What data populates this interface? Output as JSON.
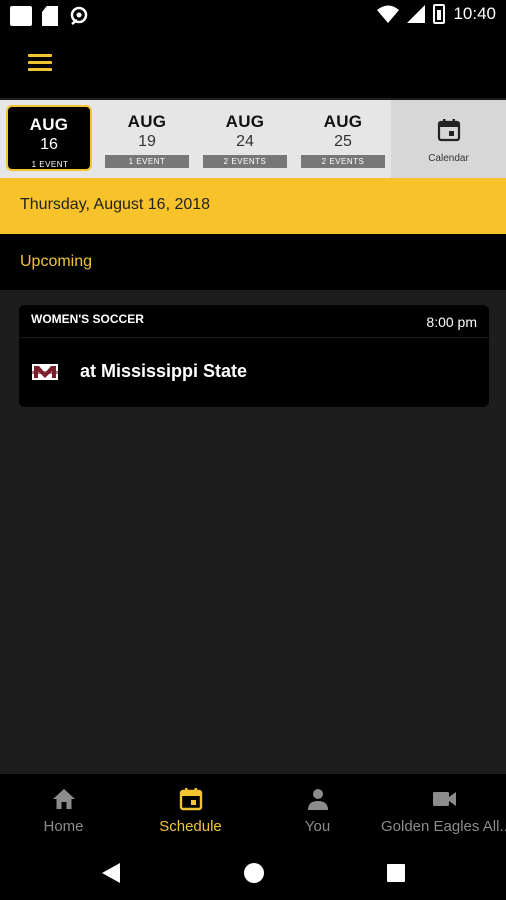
{
  "status_bar": {
    "time": "10:40",
    "icons": [
      "notification-square-icon",
      "sim-card-icon",
      "location-icon",
      "wifi-icon",
      "signal-icon",
      "battery-icon"
    ]
  },
  "app_bar": {
    "menu_icon": "hamburger-menu-icon"
  },
  "date_strip": {
    "items": [
      {
        "month": "AUG",
        "day": "16",
        "count": "1 EVENT",
        "selected": true
      },
      {
        "month": "AUG",
        "day": "19",
        "count": "1 EVENT",
        "selected": false
      },
      {
        "month": "AUG",
        "day": "24",
        "count": "2 EVENTS",
        "selected": false
      },
      {
        "month": "AUG",
        "day": "25",
        "count": "2 EVENTS",
        "selected": false
      }
    ],
    "calendar_label": "Calendar"
  },
  "selected_date": "Thursday, August 16, 2018",
  "section": {
    "title": "Upcoming"
  },
  "events": [
    {
      "sport": "WOMEN'S SOCCER",
      "time": "8:00 pm",
      "opponent": "at Mississippi State",
      "logo": "mississippi-state-logo"
    }
  ],
  "bottom_nav": {
    "items": [
      {
        "label": "Home",
        "icon": "home-icon",
        "active": false
      },
      {
        "label": "Schedule",
        "icon": "calendar-icon",
        "active": true
      },
      {
        "label": "You",
        "icon": "person-icon",
        "active": false
      },
      {
        "label": "Golden Eagles All...",
        "icon": "video-camera-icon",
        "active": false
      }
    ]
  },
  "colors": {
    "accent": "#f2c530",
    "date_banner": "#f7c22a",
    "background": "#1d1d1d",
    "bar": "#000000"
  }
}
